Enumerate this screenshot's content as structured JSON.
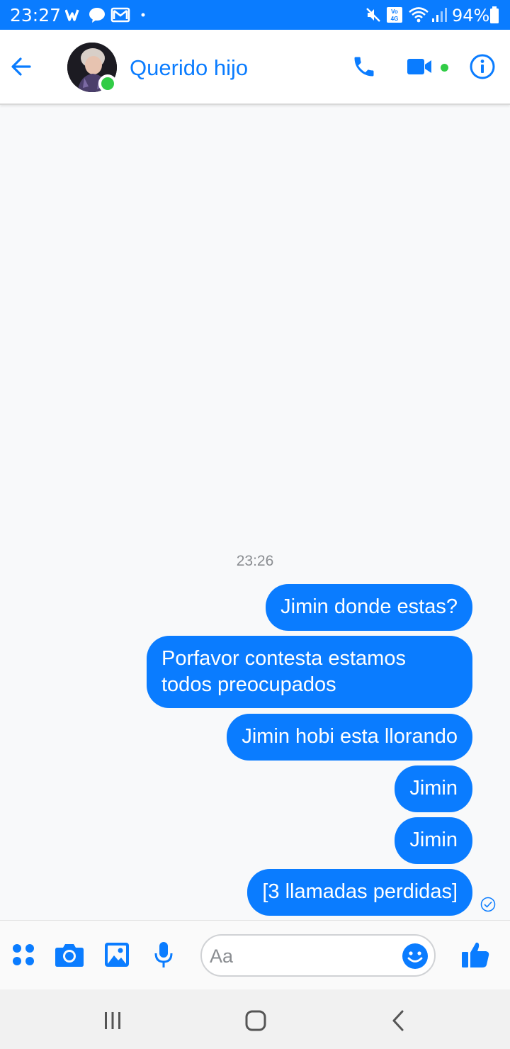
{
  "status_bar": {
    "time": "23:27",
    "battery": "94%",
    "icons": [
      "wattpad-icon",
      "messenger-icon",
      "gmail-icon",
      "dot-icon",
      "mute-icon",
      "volte-4g-icon",
      "wifi-icon",
      "signal-icon",
      "battery-icon"
    ]
  },
  "header": {
    "contact_name": "Querido hijo",
    "online": true
  },
  "conversation": {
    "timestamp": "23:26",
    "messages": [
      {
        "text": "Jimin donde estas?"
      },
      {
        "text": "Porfavor contesta estamos todos preocupados"
      },
      {
        "text": "Jimin hobi esta llorando"
      },
      {
        "text": "Jimin"
      },
      {
        "text": "Jimin"
      },
      {
        "text": "[3 llamadas perdidas]"
      }
    ]
  },
  "composer": {
    "placeholder": "Aa"
  },
  "colors": {
    "accent": "#0a7cff",
    "online": "#31cc46",
    "background": "#f8f9fa"
  }
}
